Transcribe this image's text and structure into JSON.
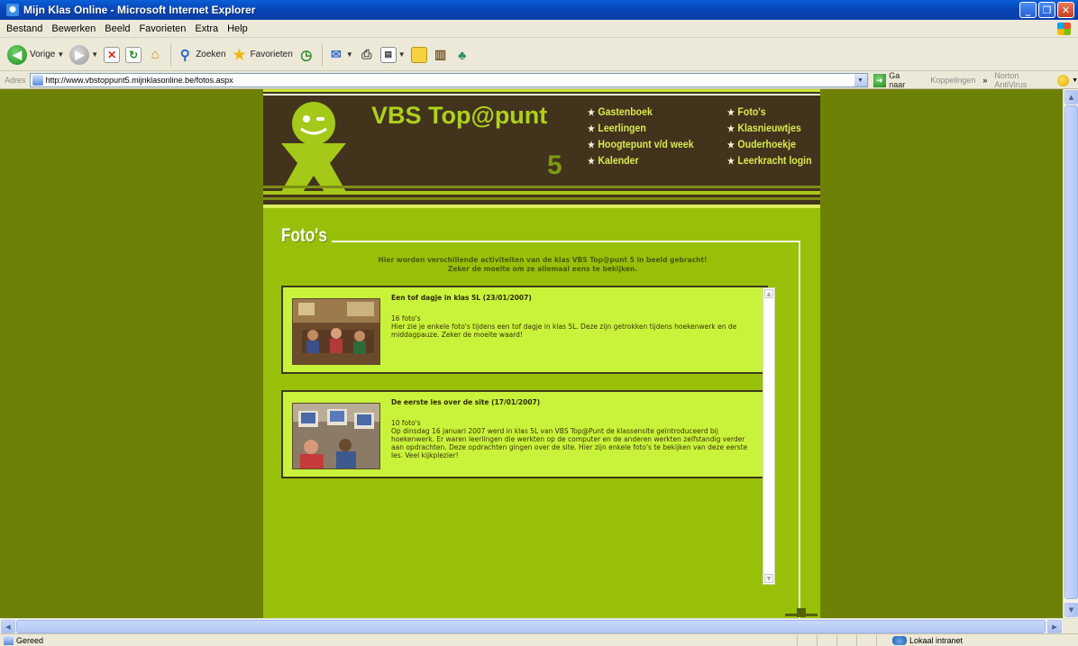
{
  "window": {
    "title": "Mijn Klas Online - Microsoft Internet Explorer"
  },
  "menu": [
    "Bestand",
    "Bewerken",
    "Beeld",
    "Favorieten",
    "Extra",
    "Help"
  ],
  "toolbar": {
    "back": "Vorige",
    "search": "Zoeken",
    "favorites": "Favorieten"
  },
  "address": {
    "label": "Adres",
    "url": "http://www.vbstoppunt5.mijnklasonline.be/fotos.aspx",
    "go": "Ga naar",
    "links": "Koppelingen",
    "chevron": "»",
    "norton": "Norton AntiVirus"
  },
  "site": {
    "title": "VBS Top@punt",
    "number": "5",
    "nav_col1": [
      "Gastenboek",
      "Leerlingen",
      "Hoogtepunt v/d week",
      "Kalender"
    ],
    "nav_col2": [
      "Foto's",
      "Klasnieuwtjes",
      "Ouderhoekje",
      "Leerkracht login"
    ]
  },
  "content": {
    "title": "Foto's",
    "intro_line1": "Hier worden verschillende activiteiten van de klas VBS Top@punt 5 in beeld gebracht!",
    "intro_line2": "Zeker de moeite om ze allemaal eens te bekijken.",
    "albums": [
      {
        "title": "Een tof dagje in klas 5L (23/01/2007)",
        "count": "16 foto's",
        "description": "Hier zie je enkele foto's tijdens een tof dagje in klas 5L. Deze zijn getrokken tijdens hoekenwerk en de middagpauze. Zeker de moeite waard!"
      },
      {
        "title": "De eerste les over de site (17/01/2007)",
        "count": "10 foto's",
        "description": "Op dinsdag 16 januari 2007 werd in klas 5L van VBS Top@Punt de klassensite geïntroduceerd bij hoekenwerk. Er waren leerlingen die werkten op de computer en de anderen werkten zelfstandig verder aan opdrachten. Deze opdrachten gingen over de site. Hier zijn enkele foto's te bekijken van deze eerste les. Veel kijkplezier!"
      }
    ]
  },
  "status": {
    "left": "Gereed",
    "zone": "Lokaal intranet"
  },
  "colors": {
    "page_bg": "#6e8107",
    "content_bg": "#98c008",
    "header_bg": "#42331d",
    "accent": "#aed11a",
    "album_bg": "#c9f33b"
  }
}
